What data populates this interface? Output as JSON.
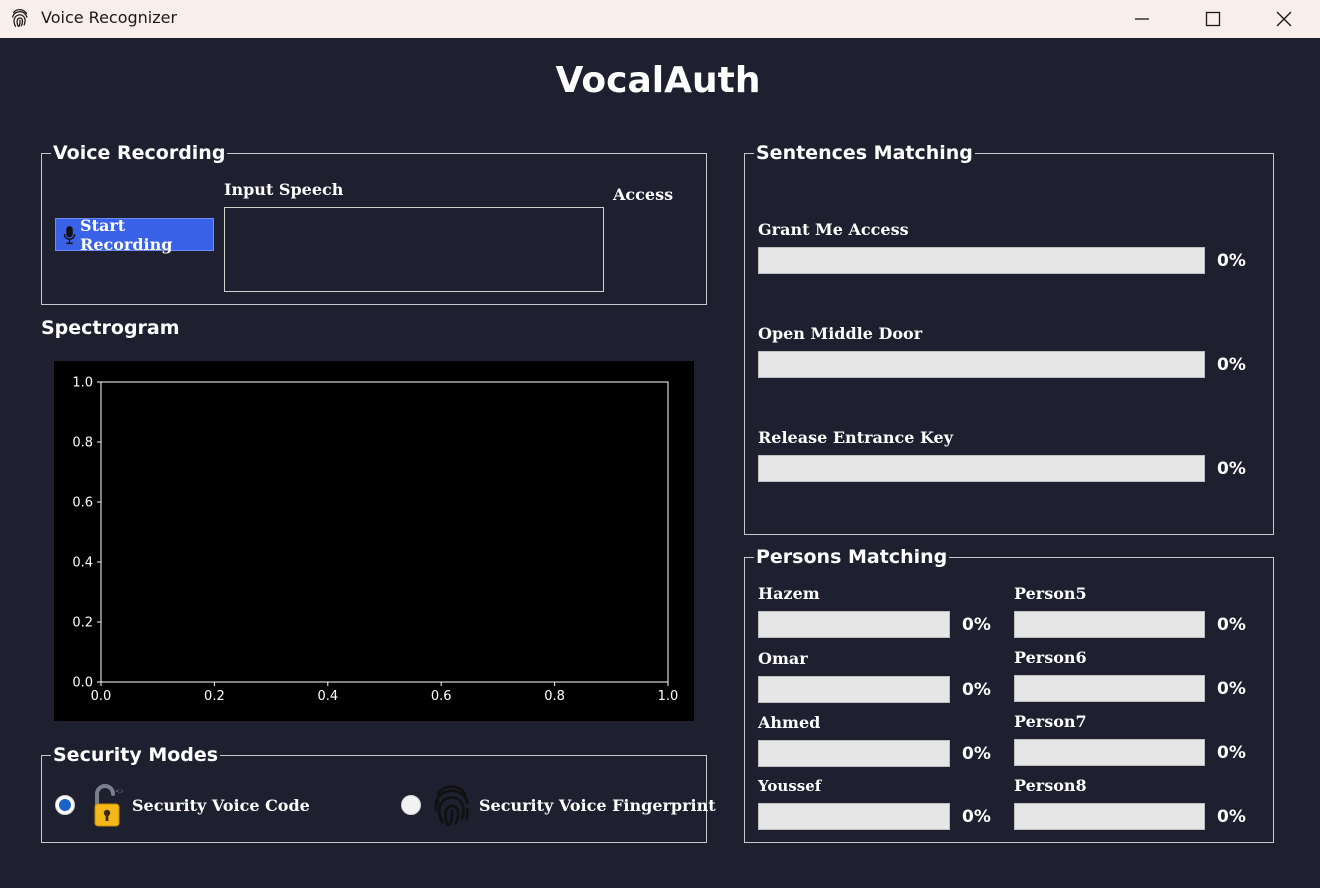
{
  "window": {
    "title": "Voice Recognizer"
  },
  "app": {
    "title": "VocalAuth"
  },
  "voice_recording": {
    "group_title": "Voice Recording",
    "start_button": "Start Recording",
    "input_speech_label": "Input Speech",
    "access_label": "Access"
  },
  "spectrogram": {
    "label": "Spectrogram"
  },
  "chart_data": {
    "type": "heatmap",
    "title": "",
    "xlabel": "",
    "ylabel": "",
    "xlim": [
      0.0,
      1.0
    ],
    "ylim": [
      0.0,
      1.0
    ],
    "xticks": [
      "0.0",
      "0.2",
      "0.4",
      "0.6",
      "0.8",
      "1.0"
    ],
    "yticks": [
      "0.0",
      "0.2",
      "0.4",
      "0.6",
      "0.8",
      "1.0"
    ],
    "values": [],
    "grid": false,
    "colors": {
      "background": "#000000",
      "axis": "#ffffff"
    }
  },
  "sentences_matching": {
    "group_title": "Sentences Matching",
    "items": [
      {
        "label": "Grant Me Access",
        "percent": "0%",
        "value": 0
      },
      {
        "label": "Open Middle Door",
        "percent": "0%",
        "value": 0
      },
      {
        "label": "Release Entrance Key",
        "percent": "0%",
        "value": 0
      }
    ]
  },
  "persons_matching": {
    "group_title": "Persons Matching",
    "left": [
      {
        "label": "Hazem",
        "percent": "0%",
        "value": 0
      },
      {
        "label": "Omar",
        "percent": "0%",
        "value": 0
      },
      {
        "label": "Ahmed",
        "percent": "0%",
        "value": 0
      },
      {
        "label": "Youssef",
        "percent": "0%",
        "value": 0
      }
    ],
    "right": [
      {
        "label": "Person5",
        "percent": "0%",
        "value": 0
      },
      {
        "label": "Person6",
        "percent": "0%",
        "value": 0
      },
      {
        "label": "Person7",
        "percent": "0%",
        "value": 0
      },
      {
        "label": "Person8",
        "percent": "0%",
        "value": 0
      }
    ]
  },
  "security_modes": {
    "group_title": "Security Modes",
    "voice_code_label": "Security Voice Code",
    "voice_fingerprint_label": "Security Voice Fingerprint",
    "selected": "voice_code"
  },
  "colors": {
    "background": "#1e1f2f",
    "titlebar": "#f8efea",
    "accent": "#3a62e8",
    "radio_selected": "#1b63c9",
    "progress_track": "#e6e6e6"
  },
  "icons": {
    "app": "fingerprint-icon",
    "record": "microphone-icon",
    "voice_code": "unlocked-padlock-icon",
    "voice_fingerprint": "fingerprint-icon"
  }
}
